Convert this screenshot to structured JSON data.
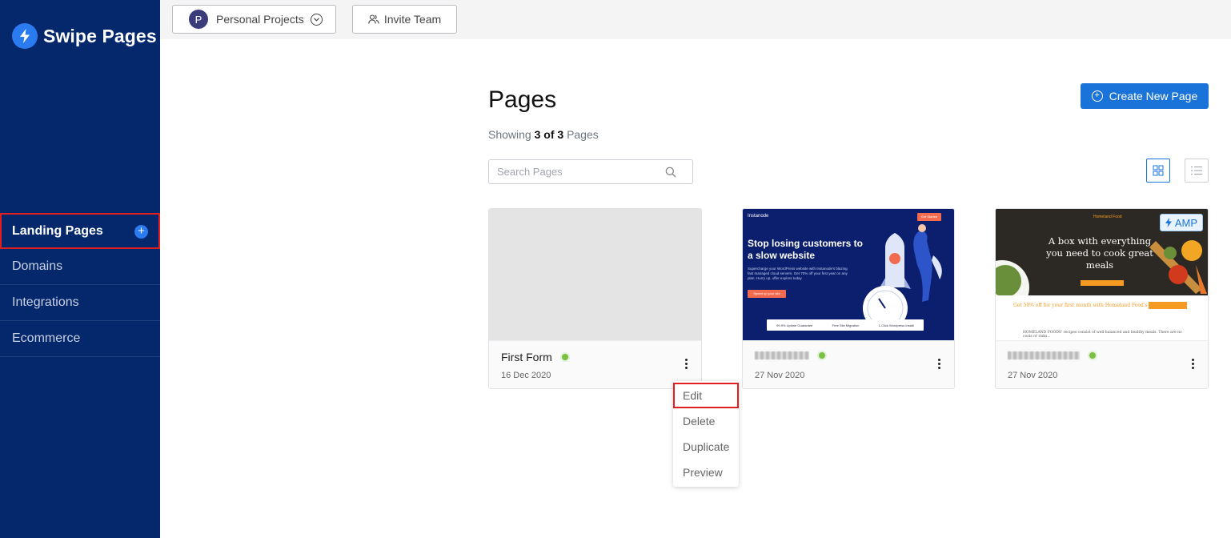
{
  "brand": {
    "name": "Swipe Pages",
    "accent": "#2b7bf0",
    "sidebar_bg": "#04286b"
  },
  "sidebar": {
    "items": [
      {
        "label": "Landing Pages",
        "active": true
      },
      {
        "label": "Domains"
      },
      {
        "label": "Integrations"
      },
      {
        "label": "Ecommerce"
      }
    ],
    "add_icon": "plus-circle-icon"
  },
  "topbar": {
    "project": {
      "avatar_letter": "P",
      "label": "Personal Projects",
      "icon": "chevron-down-circle-icon"
    },
    "invite": {
      "label": "Invite Team",
      "icon": "people-icon"
    }
  },
  "main": {
    "title": "Pages",
    "showing": {
      "prefix": "Showing",
      "count": "3 of 3",
      "suffix": "Pages"
    },
    "create_button": "Create New Page",
    "search_placeholder": "Search Pages",
    "view_modes": [
      "grid-view-icon",
      "list-view-icon"
    ]
  },
  "cards": [
    {
      "name": "First Form",
      "date": "16 Dec 2020",
      "status": "published",
      "thumbnail": "blank"
    },
    {
      "name": "",
      "date": "27 Nov 2020",
      "status": "published",
      "thumbnail": {
        "brand": "Instanode",
        "cta_top": "Get Started",
        "headline": "Stop losing customers to a slow website",
        "body": "Supercharge your WordPress website with Instanode's blazing fast managed cloud servers. Get 70% off your first year on any plan. Hurry up, offer expires today",
        "button": "Speed up your site",
        "features": [
          "99.9% Uptime Guarantee",
          "Free Site Migration",
          "1-Click Wordpress Install"
        ]
      }
    },
    {
      "name": "",
      "date": "27 Nov 2020",
      "status": "published",
      "badge": "AMP",
      "thumbnail": {
        "brand": "Homeland Food",
        "headline": "A box with everything you need to cook great meals",
        "offer": "Get 50% off for your first month with Homeland Food's",
        "text": "HOMELAND FOODS' recipes consist of well-balanced and healthy meals. There are no costs or risks..."
      }
    }
  ],
  "context_menu": {
    "items": [
      "Edit",
      "Delete",
      "Duplicate",
      "Preview"
    ],
    "highlighted": "Edit"
  }
}
